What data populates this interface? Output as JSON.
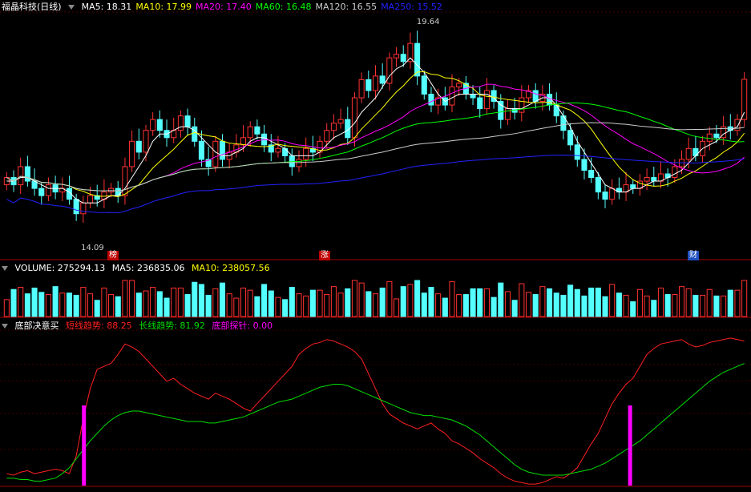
{
  "stock": {
    "name": "福晶科技(日线)"
  },
  "ma_legend": [
    {
      "label": "MA5: 18.31",
      "color": "#ffffff"
    },
    {
      "label": "MA10: 17.99",
      "color": "#ffff00"
    },
    {
      "label": "MA20: 17.40",
      "color": "#ff00ff"
    },
    {
      "label": "MA60: 16.48",
      "color": "#00ff00"
    },
    {
      "label": "MA120: 16.55",
      "color": "#cccccc"
    },
    {
      "label": "MA250: 15.52",
      "color": "#2222ff"
    }
  ],
  "price_annotations": {
    "high": "19.64",
    "low": "14.09"
  },
  "event_badges": [
    {
      "label": "榜",
      "color": "#c00000"
    },
    {
      "label": "涨",
      "color": "#c00000"
    },
    {
      "label": "财",
      "color": "#2050c0"
    }
  ],
  "volume_legend": {
    "vol": "VOLUME: 275294.13",
    "ma5": "MA5: 236835.06",
    "ma10": "MA10: 238057.56"
  },
  "indicator_legend": {
    "name": "底部决意买",
    "short": "短线趋势: 88.25",
    "long": "长线趋势: 81.92",
    "probe": "底部探针: 0.00"
  },
  "colors": {
    "up": "#ff3232",
    "down": "#54ffff",
    "short": "#ff2020",
    "long": "#00dd00",
    "probe": "#ff00ff"
  },
  "chart_data": {
    "type": "candlestick",
    "price_range": [
      13.6,
      20.1
    ],
    "close": [
      15.6,
      15.4,
      15.9,
      15.5,
      15.3,
      15.1,
      15.4,
      15.2,
      15.3,
      15.0,
      14.6,
      14.9,
      15.1,
      15.0,
      15.2,
      15.3,
      15.1,
      15.9,
      16.6,
      16.3,
      16.9,
      17.2,
      16.9,
      16.7,
      16.9,
      17.3,
      17.0,
      16.6,
      16.1,
      15.9,
      16.6,
      16.1,
      16.3,
      16.5,
      16.7,
      17.0,
      16.8,
      16.5,
      16.3,
      16.4,
      16.2,
      15.9,
      16.1,
      16.4,
      16.3,
      16.6,
      16.9,
      17.1,
      17.2,
      16.7,
      17.8,
      18.3,
      18.0,
      18.4,
      18.2,
      18.9,
      19.0,
      18.8,
      19.3,
      18.4,
      17.9,
      17.6,
      17.8,
      17.6,
      18.1,
      18.2,
      17.9,
      17.8,
      17.5,
      18.0,
      17.7,
      17.2,
      17.5,
      17.4,
      17.8,
      18.0,
      17.7,
      17.9,
      17.6,
      17.3,
      16.9,
      16.5,
      16.1,
      15.8,
      15.6,
      15.2,
      15.0,
      15.3,
      15.2,
      15.4,
      15.3,
      15.5,
      15.6,
      15.5,
      15.7,
      15.6,
      15.9,
      16.1,
      16.4,
      16.2,
      16.6,
      16.8,
      16.7,
      17.0,
      16.9,
      17.2,
      18.31
    ],
    "open": [
      15.4,
      15.6,
      15.4,
      15.9,
      15.5,
      15.3,
      15.1,
      15.4,
      15.2,
      15.3,
      15.0,
      14.6,
      14.9,
      15.1,
      15.0,
      15.2,
      15.3,
      15.1,
      15.9,
      16.6,
      16.3,
      16.9,
      17.2,
      16.9,
      16.7,
      16.9,
      17.3,
      17.0,
      16.6,
      16.1,
      15.9,
      16.6,
      16.1,
      16.3,
      16.5,
      16.7,
      17.0,
      16.8,
      16.5,
      16.3,
      16.4,
      16.2,
      15.9,
      16.1,
      16.4,
      16.3,
      16.6,
      16.9,
      17.1,
      17.2,
      16.7,
      17.8,
      18.3,
      18.0,
      18.4,
      18.2,
      18.9,
      19.0,
      18.8,
      19.3,
      18.4,
      17.9,
      17.6,
      17.8,
      17.6,
      18.1,
      18.2,
      17.9,
      17.8,
      17.5,
      18.0,
      17.7,
      17.2,
      17.5,
      17.4,
      17.8,
      18.0,
      17.7,
      17.9,
      17.6,
      17.3,
      16.9,
      16.5,
      16.1,
      15.8,
      15.6,
      15.2,
      15.0,
      15.3,
      15.2,
      15.4,
      15.3,
      15.5,
      15.6,
      15.5,
      15.7,
      15.6,
      15.9,
      16.1,
      16.4,
      16.2,
      16.6,
      16.8,
      16.7,
      17.0,
      16.9,
      17.2
    ],
    "ma5": [
      15.5,
      15.5,
      15.6,
      15.6,
      15.5,
      15.4,
      15.3,
      15.3,
      15.3,
      15.2,
      15.0,
      14.9,
      14.9,
      14.9,
      15.0,
      15.1,
      15.1,
      15.3,
      15.6,
      15.9,
      16.2,
      16.6,
      16.8,
      16.8,
      16.9,
      17.0,
      17.0,
      16.9,
      16.7,
      16.5,
      16.3,
      16.2,
      16.2,
      16.3,
      16.4,
      16.6,
      16.7,
      16.7,
      16.6,
      16.5,
      16.4,
      16.2,
      16.2,
      16.2,
      16.2,
      16.3,
      16.5,
      16.7,
      16.8,
      16.9,
      17.1,
      17.4,
      17.6,
      17.8,
      18.1,
      18.4,
      18.6,
      18.7,
      18.9,
      18.7,
      18.5,
      18.2,
      17.9,
      17.7,
      17.8,
      17.9,
      17.9,
      17.9,
      17.9,
      17.9,
      17.8,
      17.6,
      17.5,
      17.5,
      17.5,
      17.6,
      17.7,
      17.8,
      17.8,
      17.6,
      17.3,
      17.0,
      16.6,
      16.3,
      16.0,
      15.7,
      15.4,
      15.3,
      15.2,
      15.2,
      15.3,
      15.3,
      15.4,
      15.5,
      15.5,
      15.6,
      15.7,
      15.8,
      16.0,
      16.2,
      16.4,
      16.5,
      16.6,
      16.8,
      16.9,
      17.0,
      17.4
    ],
    "short_trend": [
      8,
      7,
      9,
      10,
      8,
      9,
      10,
      11,
      10,
      8,
      20,
      45,
      65,
      78,
      80,
      82,
      88,
      95,
      93,
      90,
      85,
      80,
      75,
      70,
      72,
      68,
      65,
      62,
      60,
      58,
      62,
      60,
      58,
      55,
      52,
      50,
      55,
      60,
      65,
      70,
      75,
      80,
      88,
      92,
      95,
      96,
      98,
      97,
      95,
      93,
      90,
      85,
      75,
      65,
      55,
      48,
      45,
      42,
      40,
      38,
      40,
      42,
      38,
      35,
      30,
      28,
      25,
      22,
      18,
      15,
      12,
      8,
      5,
      3,
      2,
      1,
      1,
      2,
      4,
      6,
      5,
      8,
      12,
      20,
      28,
      35,
      45,
      55,
      62,
      68,
      72,
      80,
      88,
      92,
      95,
      96,
      97,
      98,
      95,
      93,
      94,
      96,
      97,
      98,
      99,
      98,
      97
    ],
    "long_trend": [
      5,
      5,
      4,
      4,
      3,
      3,
      4,
      5,
      8,
      12,
      18,
      24,
      30,
      35,
      40,
      44,
      47,
      49,
      50,
      50,
      49,
      48,
      47,
      46,
      45,
      44,
      43,
      43,
      43,
      42,
      42,
      43,
      44,
      45,
      46,
      48,
      50,
      52,
      54,
      56,
      57,
      58,
      60,
      62,
      64,
      66,
      67,
      68,
      68,
      67,
      65,
      63,
      61,
      59,
      57,
      55,
      53,
      51,
      49,
      48,
      47,
      47,
      46,
      45,
      44,
      42,
      40,
      37,
      34,
      30,
      26,
      22,
      18,
      14,
      11,
      9,
      8,
      7,
      7,
      7,
      7,
      8,
      9,
      10,
      11,
      13,
      15,
      18,
      21,
      24,
      27,
      30,
      34,
      38,
      42,
      46,
      50,
      54,
      58,
      62,
      66,
      70,
      73,
      76,
      78,
      80,
      81.92
    ],
    "probe_days": [
      24,
      184
    ]
  }
}
